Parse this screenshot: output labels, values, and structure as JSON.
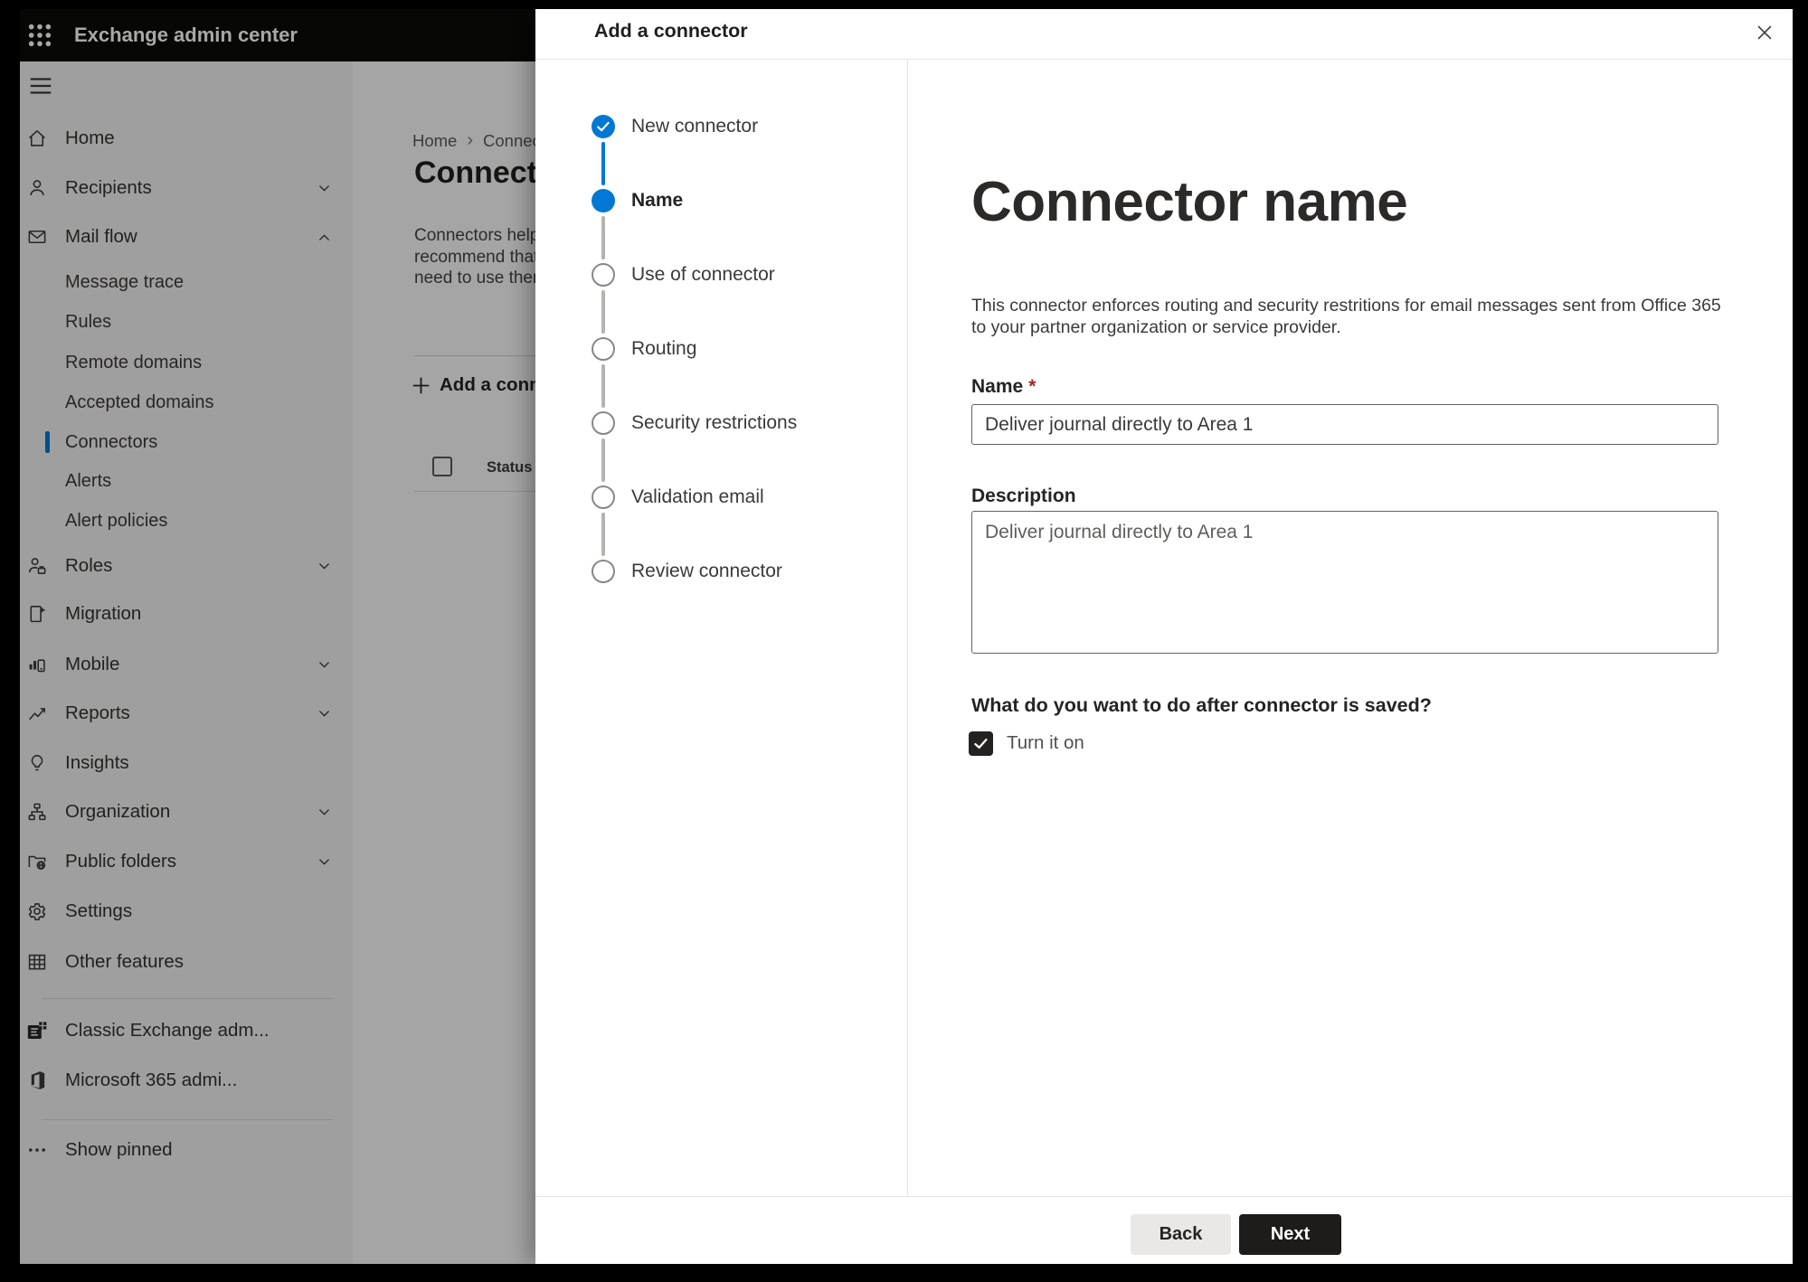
{
  "topbar": {
    "title": "Exchange admin center"
  },
  "sidebar": {
    "items": [
      {
        "label": "Home"
      },
      {
        "label": "Recipients",
        "chevron": "down"
      },
      {
        "label": "Mail flow",
        "chevron": "up"
      },
      {
        "label": "Message trace"
      },
      {
        "label": "Rules"
      },
      {
        "label": "Remote domains"
      },
      {
        "label": "Accepted domains"
      },
      {
        "label": "Connectors",
        "selected": true
      },
      {
        "label": "Alerts"
      },
      {
        "label": "Alert policies"
      },
      {
        "label": "Roles",
        "chevron": "down"
      },
      {
        "label": "Migration"
      },
      {
        "label": "Mobile",
        "chevron": "down"
      },
      {
        "label": "Reports",
        "chevron": "down"
      },
      {
        "label": "Insights"
      },
      {
        "label": "Organization",
        "chevron": "down"
      },
      {
        "label": "Public folders",
        "chevron": "down"
      },
      {
        "label": "Settings"
      },
      {
        "label": "Other features"
      },
      {
        "label": "Classic Exchange adm..."
      },
      {
        "label": "Microsoft 365 admi..."
      },
      {
        "label": "Show pinned"
      }
    ]
  },
  "page": {
    "breadcrumb": {
      "home": "Home",
      "current": "Connectors"
    },
    "title": "Connectors",
    "description_lines": [
      "Connectors help",
      "recommend that",
      "need to use them"
    ],
    "add_button": "Add a connector",
    "table_header": "Status"
  },
  "modal": {
    "title": "Add a connector",
    "steps": [
      {
        "label": "New connector",
        "state": "completed"
      },
      {
        "label": "Name",
        "state": "current"
      },
      {
        "label": "Use of connector",
        "state": "upcoming"
      },
      {
        "label": "Routing",
        "state": "upcoming"
      },
      {
        "label": "Security restrictions",
        "state": "upcoming"
      },
      {
        "label": "Validation email",
        "state": "upcoming"
      },
      {
        "label": "Review connector",
        "state": "upcoming"
      }
    ],
    "content": {
      "heading": "Connector name",
      "description_lines": [
        "This connector enforces routing and security restritions for email messages sent from Office 365",
        "to your partner organization or service provider."
      ],
      "name_label": "Name",
      "required_mark": "*",
      "name_value": "Deliver journal directly to Area 1",
      "description_label": "Description",
      "description_value": "Deliver journal directly to Area 1",
      "after_save_question": "What do you want to do after connector is saved?",
      "turn_on_label": "Turn it on",
      "turn_on_checked": true
    },
    "footer": {
      "back": "Back",
      "next": "Next"
    }
  },
  "colors": {
    "accent": "#0078d4",
    "topbar_bg": "#0b0b0a",
    "next_button_bg": "#1d1c1b",
    "required_mark": "#a4262c"
  }
}
